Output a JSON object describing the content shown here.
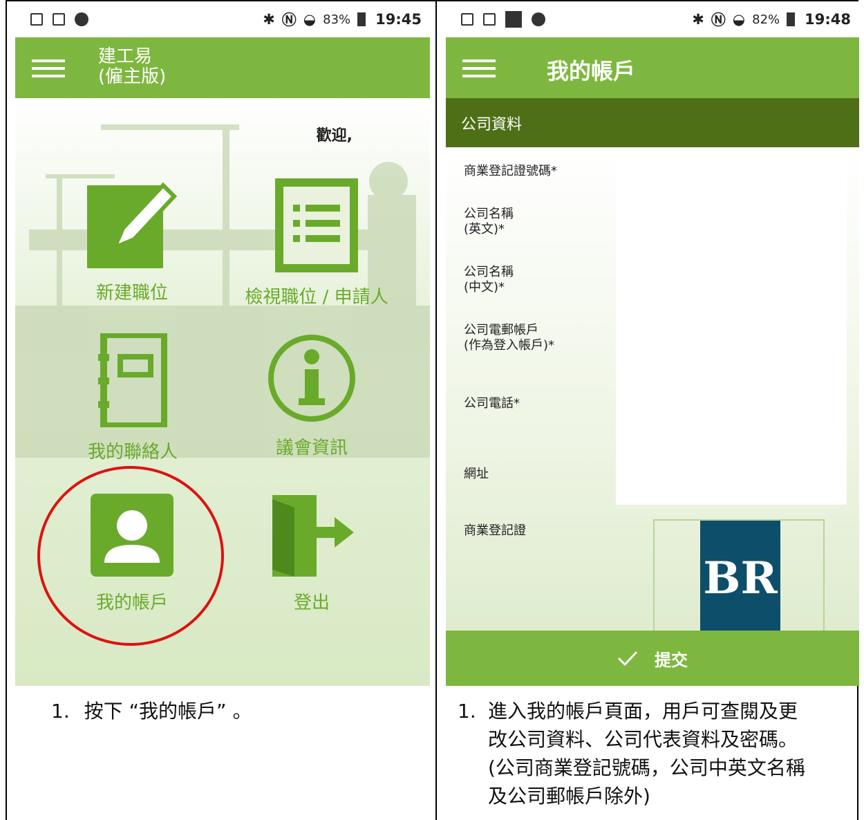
{
  "left_screen": {
    "status": {
      "battery": "83%",
      "time": "19:45"
    },
    "appbar": {
      "title_line1": "建工易",
      "title_line2": "(僱主版)"
    },
    "welcome": "歡迎,",
    "tiles": [
      {
        "label": "新建職位",
        "icon": "pencil-square-icon"
      },
      {
        "label": "檢視職位 / 申請人",
        "icon": "list-document-icon"
      },
      {
        "label": "我的聯絡人",
        "icon": "address-book-icon"
      },
      {
        "label": "議會資訊",
        "icon": "info-circle-icon"
      },
      {
        "label": "我的帳戶",
        "icon": "account-person-icon"
      },
      {
        "label": "登出",
        "icon": "logout-door-icon"
      }
    ]
  },
  "right_screen": {
    "status": {
      "battery": "82%",
      "time": "19:48"
    },
    "appbar": {
      "title": "我的帳戶"
    },
    "section": "公司資料",
    "fields": [
      {
        "line1": "商業登記證號碼*",
        "line2": ""
      },
      {
        "line1": "公司名稱",
        "line2": "(英文)*"
      },
      {
        "line1": "公司名稱",
        "line2": "(中文)*"
      },
      {
        "line1": "公司電郵帳戶",
        "line2": "(作為登入帳戶)*"
      },
      {
        "line1": "公司電話*",
        "line2": ""
      },
      {
        "line1": "網址",
        "line2": ""
      },
      {
        "line1": "商業登記證",
        "line2": ""
      }
    ],
    "br_logo_text": "BR",
    "submit_label": "提交"
  },
  "captions": {
    "left_num": "1.",
    "left_text": "按下 “我的帳戶” 。",
    "right_num": "1.",
    "right_lines": [
      "進入我的帳戶頁面，用戶可查閱及更",
      "改公司資料、公司代表資料及密碼。",
      "(公司商業登記號碼，公司中英文名稱",
      "及公司郵帳戶除外)"
    ]
  },
  "colors": {
    "accent": "#7eb740",
    "dark_header": "#4f6f17",
    "icon_green": "#6aaa2b",
    "highlight_circle": "#e01010",
    "br_blue": "#0d4e6a"
  }
}
